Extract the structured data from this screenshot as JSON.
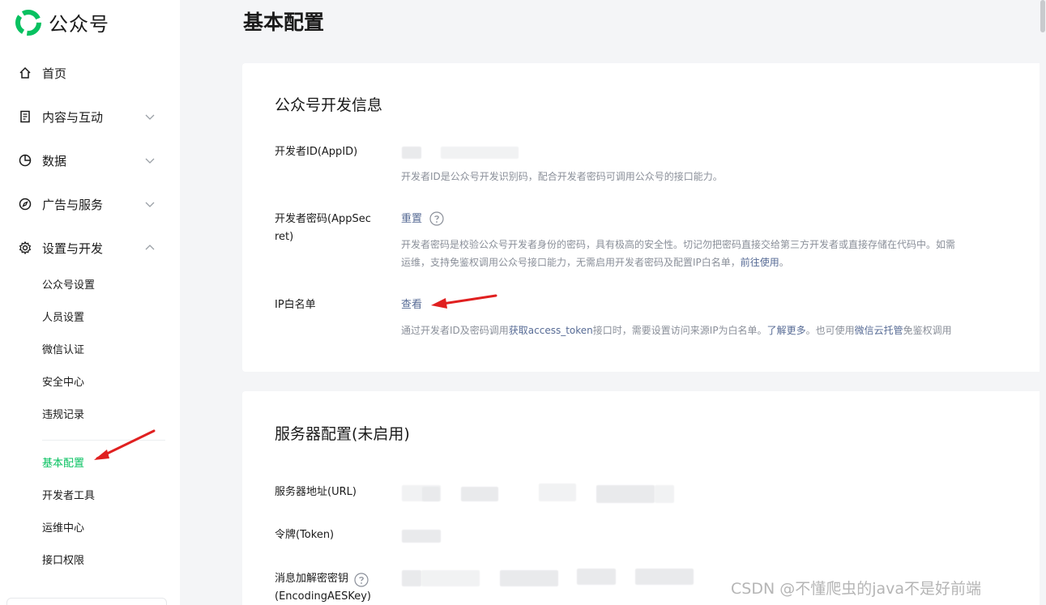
{
  "app": {
    "name": "公众号",
    "brand_color": "#07c160"
  },
  "sidebar": {
    "nav": [
      {
        "label": "首页",
        "icon": "home-icon"
      },
      {
        "label": "内容与互动",
        "icon": "document-icon",
        "expandable": true
      },
      {
        "label": "数据",
        "icon": "pie-chart-icon",
        "expandable": true
      },
      {
        "label": "广告与服务",
        "icon": "compass-icon",
        "expandable": true
      },
      {
        "label": "设置与开发",
        "icon": "gear-icon",
        "expanded": true
      }
    ],
    "sub_items": [
      {
        "label": "公众号设置"
      },
      {
        "label": "人员设置"
      },
      {
        "label": "微信认证"
      },
      {
        "label": "安全中心"
      },
      {
        "label": "违规记录"
      },
      {
        "label": "基本配置",
        "active": true
      },
      {
        "label": "开发者工具"
      },
      {
        "label": "运维中心"
      },
      {
        "label": "接口权限"
      }
    ]
  },
  "main": {
    "page_title": "基本配置",
    "dev_info": {
      "title": "公众号开发信息",
      "appid_label": "开发者ID(AppID)",
      "appid_desc": "开发者ID是公众号开发识别码，配合开发者密码可调用公众号的接口能力。",
      "secret_label_1": "开发者密码(AppSec",
      "secret_label_2": "ret)",
      "secret_action": "重置",
      "secret_desc_1": "开发者密码是校验公众号开发者身份的密码，具有极高的安全性。切记勿把密码直接交给第三方开发者或直接存储在代码中。如需",
      "secret_desc_2a": "运维，支持免鉴权调用公众号接口能力，无需启用开发者密码及配置IP白名单，",
      "secret_desc_2b": "前往使用",
      "secret_desc_2c": "。",
      "ip_label": "IP白名单",
      "ip_action": "查看",
      "ip_desc_a": "通过开发者ID及密码调用",
      "ip_desc_b": "获取access_token",
      "ip_desc_c": "接口时，需要设置访问来源IP为白名单。",
      "ip_desc_d": "了解更多",
      "ip_desc_e": "。也可使用",
      "ip_desc_f": "微信云托管",
      "ip_desc_g": "免鉴权调用"
    },
    "server_config": {
      "title": "服务器配置(未启用)",
      "url_label": "服务器地址(URL)",
      "token_label": "令牌(Token)",
      "aes_label_1": "消息加解密密钥",
      "aes_label_2": "(EncodingAESKey)"
    }
  },
  "watermark": "CSDN @不懂爬虫的java不是好前端",
  "annotation_color": "#e02020"
}
